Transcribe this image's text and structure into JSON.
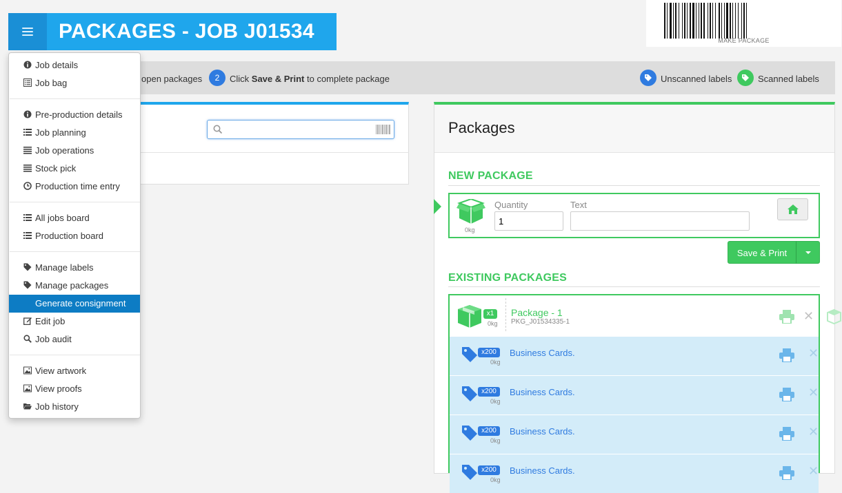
{
  "header": {
    "title": "PACKAGES - JOB J01534",
    "menu_icon": "hamburger-icon"
  },
  "barcode": {
    "label": "MAKE PACKAGE"
  },
  "steps": {
    "step1_text": "open packages",
    "step2_number": "2",
    "step2_prefix": "Click ",
    "step2_bold": "Save & Print",
    "step2_suffix": " to complete package",
    "unscanned": "Unscanned labels",
    "scanned": "Scanned labels",
    "unscanned_color": "#2f7be0",
    "scanned_color": "#3fc95f"
  },
  "menu": {
    "items": [
      {
        "label": "Job details",
        "icon": "info-icon"
      },
      {
        "label": "Job bag",
        "icon": "list-alt-icon"
      },
      {
        "label": "Pre-production details",
        "icon": "info-icon"
      },
      {
        "label": "Job planning",
        "icon": "list-icon"
      },
      {
        "label": "Job operations",
        "icon": "align-justify-icon"
      },
      {
        "label": "Stock pick",
        "icon": "align-justify-icon"
      },
      {
        "label": "Production time entry",
        "icon": "clock-icon"
      },
      {
        "label": "All jobs board",
        "icon": "list-icon"
      },
      {
        "label": "Production board",
        "icon": "list-icon"
      },
      {
        "label": "Manage labels",
        "icon": "tag-icon"
      },
      {
        "label": "Manage packages",
        "icon": "tag-icon"
      },
      {
        "label": "Generate consignment",
        "icon": "list-icon",
        "active": true
      },
      {
        "label": "Edit job",
        "icon": "edit-icon"
      },
      {
        "label": "Job audit",
        "icon": "search-icon"
      },
      {
        "label": "View artwork",
        "icon": "picture-icon"
      },
      {
        "label": "View proofs",
        "icon": "picture-icon"
      },
      {
        "label": "Job history",
        "icon": "folder-open-icon"
      }
    ]
  },
  "search": {
    "placeholder": ""
  },
  "packages": {
    "title": "Packages",
    "new_heading": "NEW PACKAGE",
    "quantity_label": "Quantity",
    "quantity_value": "1",
    "text_label": "Text",
    "text_value": "",
    "new_weight": "0kg",
    "save_label": "Save & Print",
    "existing_heading": "EXISTING PACKAGES",
    "package": {
      "name": "Package - 1",
      "code": "PKG_J01534335-1",
      "count": "x1",
      "weight": "0kg"
    },
    "items": [
      {
        "name": "Business Cards.",
        "count": "x200",
        "weight": "0kg"
      },
      {
        "name": "Business Cards.",
        "count": "x200",
        "weight": "0kg"
      },
      {
        "name": "Business Cards.",
        "count": "x200",
        "weight": "0kg"
      },
      {
        "name": "Business Cards.",
        "count": "x200",
        "weight": "0kg"
      }
    ]
  }
}
